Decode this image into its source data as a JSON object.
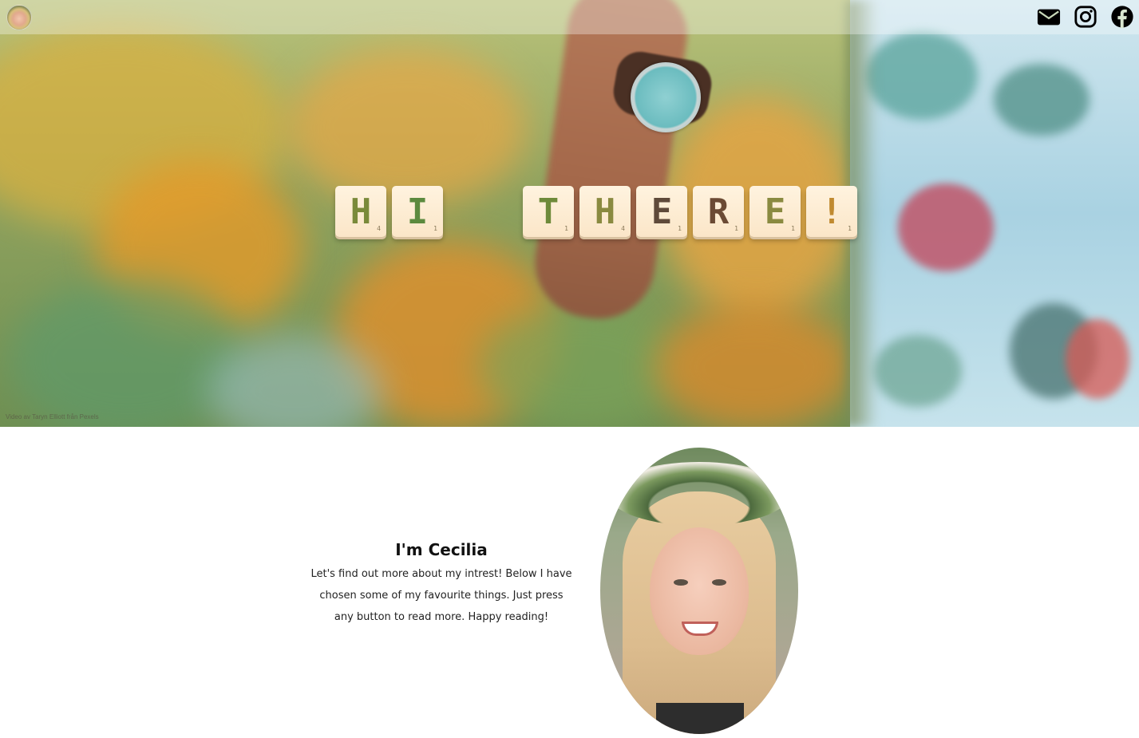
{
  "nav": {
    "avatar": "profile-avatar",
    "icons": [
      {
        "name": "mail-icon"
      },
      {
        "name": "instagram-icon"
      },
      {
        "name": "facebook-icon"
      }
    ]
  },
  "hero": {
    "tiles": [
      {
        "letter": "H",
        "points": "4"
      },
      {
        "letter": "I",
        "points": "1"
      },
      {
        "letter": " ",
        "points": ""
      },
      {
        "letter": "T",
        "points": "1"
      },
      {
        "letter": "H",
        "points": "4"
      },
      {
        "letter": "E",
        "points": "1"
      },
      {
        "letter": "R",
        "points": "1"
      },
      {
        "letter": "E",
        "points": "1"
      },
      {
        "letter": "!",
        "points": "1"
      }
    ],
    "credit": "Video av Taryn Elliott från Pexels"
  },
  "about": {
    "title": "I'm Cecilia",
    "line1": "Let's find out more about my intrest! Below I have",
    "line2": "chosen some of my favourite things. Just press",
    "line3": "any button to read more. Happy reading!"
  },
  "colors": {
    "tile_face": "#fff3df",
    "tile_letter_green": "#6e8a3a",
    "tile_letter_brown": "#6b4a34",
    "heading": "#111111"
  }
}
